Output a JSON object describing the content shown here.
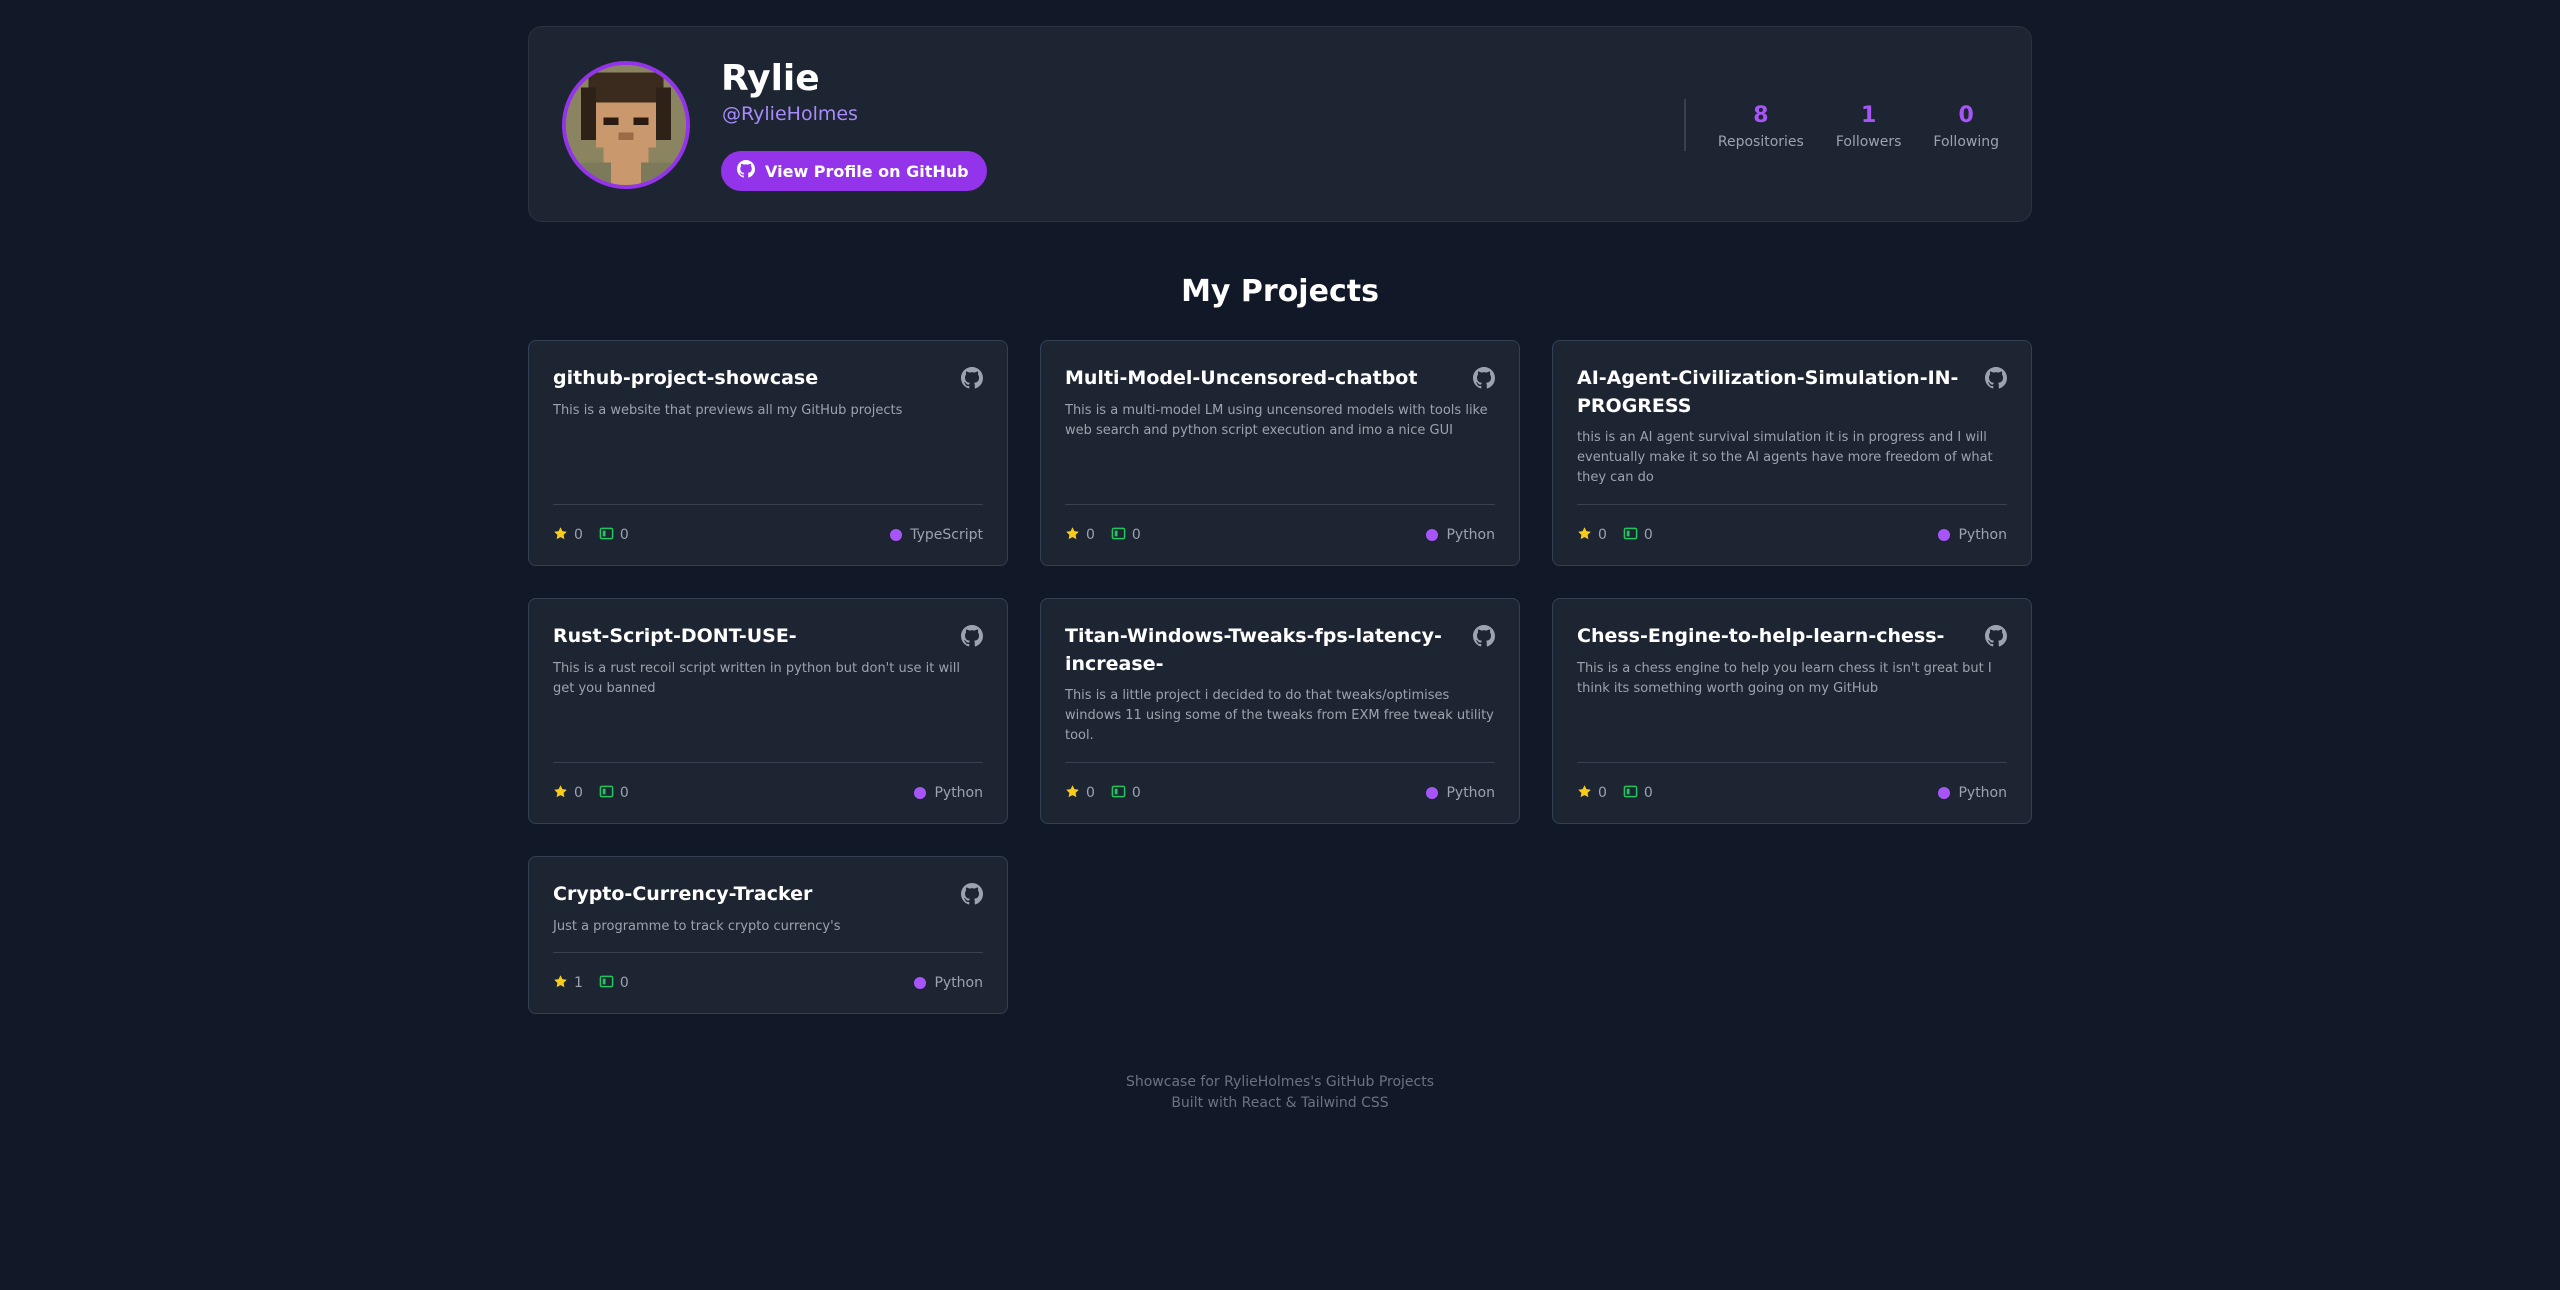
{
  "profile": {
    "name": "Rylie",
    "handle": "@RylieHolmes",
    "button_label": "View Profile on GitHub",
    "stats": [
      {
        "value": "8",
        "label": "Repositories"
      },
      {
        "value": "1",
        "label": "Followers"
      },
      {
        "value": "0",
        "label": "Following"
      }
    ]
  },
  "section_title": "My Projects",
  "projects": [
    {
      "title": "github-project-showcase",
      "desc": "This is a website that previews all my GitHub projects",
      "stars": "0",
      "forks": "0",
      "language": "TypeScript"
    },
    {
      "title": "Multi-Model-Uncensored-chatbot",
      "desc": "This is a multi-model LM using uncensored models with tools like web search and python script execution and imo a nice GUI",
      "stars": "0",
      "forks": "0",
      "language": "Python"
    },
    {
      "title": "AI-Agent-Civilization-Simulation-IN-PROGRESS",
      "desc": "this is an AI agent survival simulation it is in progress and I will eventually make it so the AI agents have more freedom of what they can do",
      "stars": "0",
      "forks": "0",
      "language": "Python"
    },
    {
      "title": "Rust-Script-DONT-USE-",
      "desc": "This is a rust recoil script written in python but don't use it will get you banned",
      "stars": "0",
      "forks": "0",
      "language": "Python"
    },
    {
      "title": "Titan-Windows-Tweaks-fps-latency-increase-",
      "desc": "This is a little project i decided to do that tweaks/optimises windows 11 using some of the tweaks from EXM free tweak utility tool.",
      "stars": "0",
      "forks": "0",
      "language": "Python"
    },
    {
      "title": "Chess-Engine-to-help-learn-chess-",
      "desc": "This is a chess engine to help you learn chess it isn't great but I think its something worth going on my GitHub",
      "stars": "0",
      "forks": "0",
      "language": "Python"
    },
    {
      "title": "Crypto-Currency-Tracker",
      "desc": "Just a programme to track crypto currency's",
      "stars": "1",
      "forks": "0",
      "language": "Python"
    }
  ],
  "footer": {
    "line1": "Showcase for RylieHolmes's GitHub Projects",
    "line2": "Built with React & Tailwind CSS"
  },
  "colors": {
    "background": "#111827",
    "card": "#1e2532",
    "accent": "#9333ea",
    "star": "#facc15",
    "fork": "#22c55e"
  },
  "icons": {
    "github": "github-icon",
    "star": "star-icon",
    "fork": "repo-forked-icon"
  }
}
